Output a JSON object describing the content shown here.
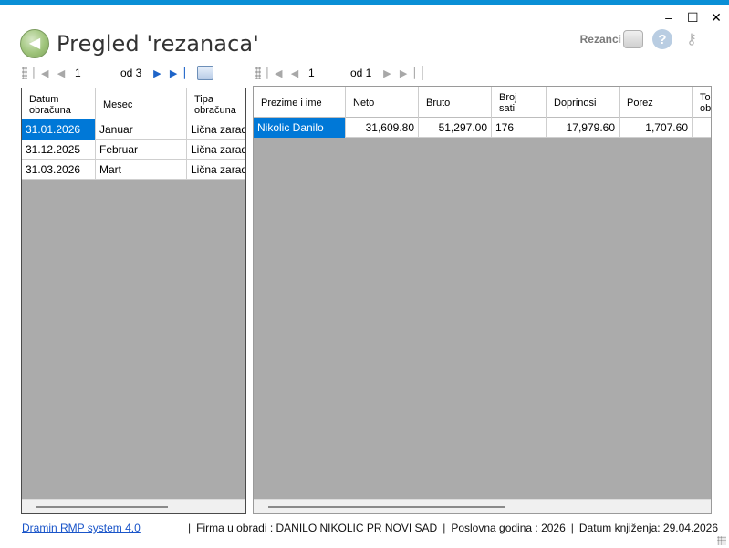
{
  "window": {
    "minimize": "–",
    "maximize": "☐",
    "close": "✕"
  },
  "header": {
    "back_glyph": "◀",
    "title": "Pregled 'rezanaca'"
  },
  "toolbar": {
    "rezanci_label": "Rezanci",
    "help_glyph": "?",
    "keys_glyph": "⚷"
  },
  "left_nav": {
    "position": "1",
    "of_label": "od 3"
  },
  "right_nav": {
    "position": "1",
    "of_label": "od 1"
  },
  "left_grid": {
    "headers": [
      "Datum\nobračuna",
      "Mesec",
      "Tipa\nobračuna"
    ],
    "rows": [
      [
        "31.01.2026",
        "Januar",
        "Lična zarada"
      ],
      [
        "31.12.2025",
        "Februar",
        "Lična zarada"
      ],
      [
        "31.03.2026",
        "Mart",
        "Lična zarada"
      ]
    ]
  },
  "right_grid": {
    "headers": [
      "Prezime i ime",
      "Neto",
      "Bruto",
      "Broj\nsati",
      "Doprinosi",
      "Porez",
      "To\nobr"
    ],
    "rows": [
      [
        "Nikolic Danilo",
        "31,609.80",
        "51,297.00",
        "176",
        "17,979.60",
        "1,707.60",
        ""
      ]
    ]
  },
  "status": {
    "link": "Dramin RMP system 4.0",
    "sep": "|",
    "firma": "Firma u obradi : DANILO NIKOLIC PR NOVI SAD",
    "godina": "Poslovna godina : 2026",
    "datum": "Datum knjiženja: 29.04.2026"
  },
  "icons": {
    "back": "back-arrow-icon",
    "rezanci": "rezanci-icon",
    "help": "help-icon",
    "keys": "keys-icon",
    "nav_first": "first-record-icon",
    "nav_prev": "previous-record-icon",
    "nav_next": "next-record-icon",
    "nav_last": "last-record-icon",
    "print": "print-icon"
  },
  "colors": {
    "title_bar": "#0a8fd6",
    "selection": "#0078d7",
    "grid_background": "#ababab",
    "link": "#1a55c9"
  }
}
